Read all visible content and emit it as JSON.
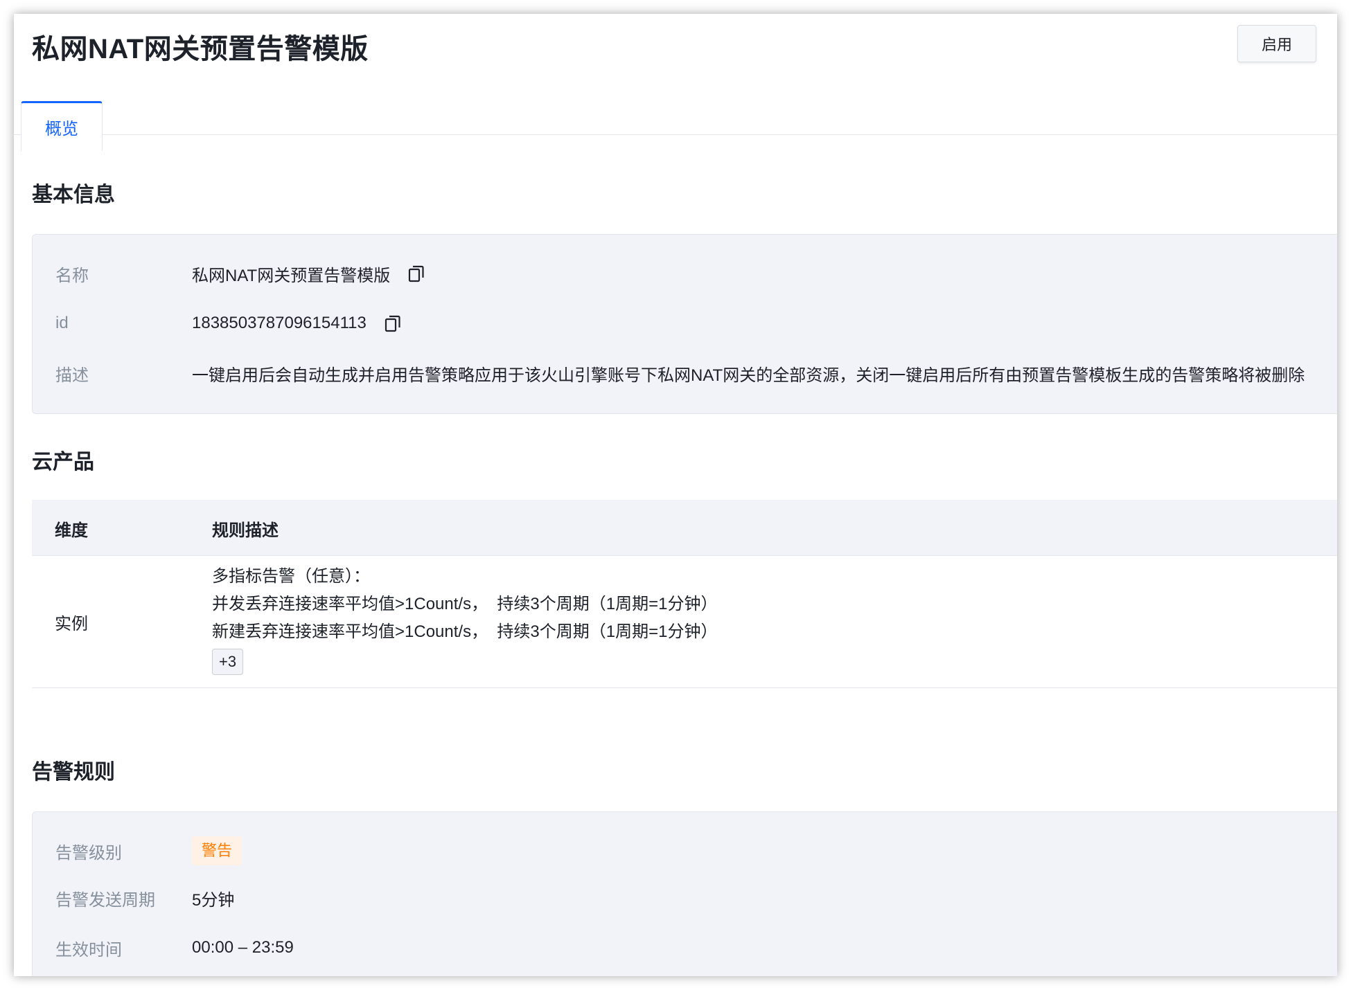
{
  "header": {
    "title": "私网NAT网关预置告警模版",
    "enable_button": "启用"
  },
  "tabs": [
    {
      "label": "概览",
      "active": true
    }
  ],
  "basic_info": {
    "section_title": "基本信息",
    "name_label": "名称",
    "name_value": "私网NAT网关预置告警模版",
    "id_label": "id",
    "id_value": "1838503787096154113",
    "desc_label": "描述",
    "desc_value": "一键启用后会自动生成并启用告警策略应用于该火山引擎账号下私网NAT网关的全部资源，关闭一键启用后所有由预置告警模板生成的告警策略将被删除"
  },
  "cloud_product": {
    "section_title": "云产品",
    "columns": [
      "维度",
      "规则描述"
    ],
    "rows": [
      {
        "dimension": "实例",
        "rule_heading": "多指标告警（任意）：",
        "rules": [
          "并发丢弃连接速率平均值>1Count/s，  持续3个周期（1周期=1分钟）",
          "新建丢弃连接速率平均值>1Count/s，  持续3个周期（1周期=1分钟）"
        ],
        "more_tag": "+3"
      }
    ]
  },
  "alert_rules": {
    "section_title": "告警规则",
    "level_label": "告警级别",
    "level_value": "警告",
    "period_label": "告警发送周期",
    "period_value": "5分钟",
    "time_label": "生效时间",
    "time_value": "00:00 – 23:59"
  },
  "colors": {
    "accent": "#1664ff",
    "warning_text": "#ff7d00",
    "warning_bg": "#fff1e6",
    "panel_bg": "#f2f3f8"
  }
}
